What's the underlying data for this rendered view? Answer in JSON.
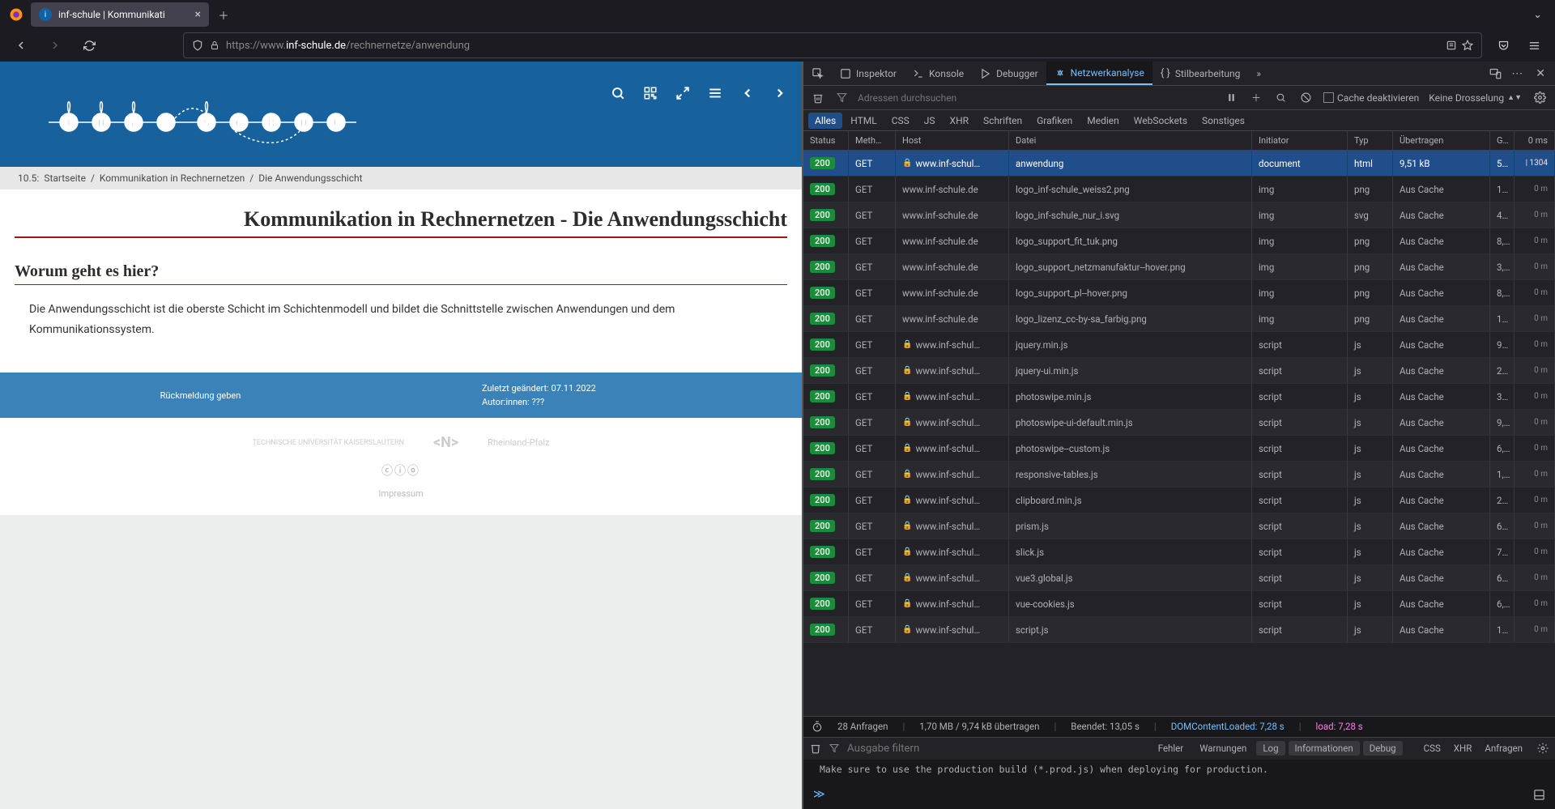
{
  "browser": {
    "tab_title": "inf-schule | Kommunikati",
    "url_prefix": "https://www.",
    "url_host": "inf-schule.de",
    "url_path": "/rechnernetze/anwendung"
  },
  "page": {
    "breadcrumb_prefix": "10.5:",
    "breadcrumb": [
      "Startseite",
      "Kommunikation in Rechnernetzen",
      "Die Anwendungsschicht"
    ],
    "title": "Kommunikation in Rechnernetzen - Die Anwendungsschicht",
    "section_heading": "Worum geht es hier?",
    "section_text": "Die Anwendungsschicht ist die oberste Schicht im Schichtenmodell und bildet die Schnittstelle zwischen Anwendungen und dem Kommunikationssystem.",
    "footer_feedback": "Rückmeldung geben",
    "footer_modified": "Zuletzt geändert: 07.11.2022",
    "footer_authors": "Autor:innen: ???",
    "sponsors": [
      "TECHNISCHE UNIVERSITÄT KAISERSLAUTERN",
      "<N>",
      "Rheinland-Pfalz"
    ],
    "cc_icons": "ⓒⓘⓞ",
    "impressum": "Impressum"
  },
  "devtools": {
    "tabs": {
      "picker": "",
      "inspector": "Inspektor",
      "console": "Konsole",
      "debugger": "Debugger",
      "network": "Netzwerkanalyse",
      "style": "Stilbearbeitung",
      "more": "»"
    },
    "toolbar": {
      "filter_placeholder": "Adressen durchsuchen",
      "cache_label": "Cache deaktivieren",
      "throttle": "Keine Drosselung"
    },
    "filters": [
      "Alles",
      "HTML",
      "CSS",
      "JS",
      "XHR",
      "Schriften",
      "Grafiken",
      "Medien",
      "WebSockets",
      "Sonstiges"
    ],
    "columns": {
      "status": "Status",
      "method": "Meth…",
      "host": "Host",
      "file": "Datei",
      "initiator": "Initiator",
      "type": "Typ",
      "transferred": "Übertragen",
      "size": "G…",
      "waterfall": "0 ms"
    },
    "requests": [
      {
        "status": "200",
        "method": "GET",
        "host": "www.inf-schul…",
        "lock": true,
        "file": "anwendung",
        "initiator": "document",
        "type": "html",
        "transferred": "9,51 kB",
        "size": "5…",
        "selected": true
      },
      {
        "status": "200",
        "method": "GET",
        "host": "www.inf-schule.de",
        "lock": false,
        "file": "logo_inf-schule_weiss2.png",
        "initiator": "img",
        "type": "png",
        "transferred": "Aus Cache",
        "size": "1…"
      },
      {
        "status": "200",
        "method": "GET",
        "host": "www.inf-schule.de",
        "lock": false,
        "file": "logo_inf-schule_nur_i.svg",
        "initiator": "img",
        "type": "svg",
        "transferred": "Aus Cache",
        "size": "4…"
      },
      {
        "status": "200",
        "method": "GET",
        "host": "www.inf-schule.de",
        "lock": false,
        "file": "logo_support_fit_tuk.png",
        "initiator": "img",
        "type": "png",
        "transferred": "Aus Cache",
        "size": "8,…"
      },
      {
        "status": "200",
        "method": "GET",
        "host": "www.inf-schule.de",
        "lock": false,
        "file": "logo_support_netzmanufaktur--hover.png",
        "initiator": "img",
        "type": "png",
        "transferred": "Aus Cache",
        "size": "3,…"
      },
      {
        "status": "200",
        "method": "GET",
        "host": "www.inf-schule.de",
        "lock": false,
        "file": "logo_support_pl--hover.png",
        "initiator": "img",
        "type": "png",
        "transferred": "Aus Cache",
        "size": "8,…"
      },
      {
        "status": "200",
        "method": "GET",
        "host": "www.inf-schule.de",
        "lock": false,
        "file": "logo_lizenz_cc-by-sa_farbig.png",
        "initiator": "img",
        "type": "png",
        "transferred": "Aus Cache",
        "size": "1…"
      },
      {
        "status": "200",
        "method": "GET",
        "host": "www.inf-schul…",
        "lock": true,
        "file": "jquery.min.js",
        "initiator": "script",
        "type": "js",
        "transferred": "Aus Cache",
        "size": "9…"
      },
      {
        "status": "200",
        "method": "GET",
        "host": "www.inf-schul…",
        "lock": true,
        "file": "jquery-ui.min.js",
        "initiator": "script",
        "type": "js",
        "transferred": "Aus Cache",
        "size": "2…"
      },
      {
        "status": "200",
        "method": "GET",
        "host": "www.inf-schul…",
        "lock": true,
        "file": "photoswipe.min.js",
        "initiator": "script",
        "type": "js",
        "transferred": "Aus Cache",
        "size": "3…"
      },
      {
        "status": "200",
        "method": "GET",
        "host": "www.inf-schul…",
        "lock": true,
        "file": "photoswipe-ui-default.min.js",
        "initiator": "script",
        "type": "js",
        "transferred": "Aus Cache",
        "size": "9,…"
      },
      {
        "status": "200",
        "method": "GET",
        "host": "www.inf-schul…",
        "lock": true,
        "file": "photoswipe--custom.js",
        "initiator": "script",
        "type": "js",
        "transferred": "Aus Cache",
        "size": "6,…"
      },
      {
        "status": "200",
        "method": "GET",
        "host": "www.inf-schul…",
        "lock": true,
        "file": "responsive-tables.js",
        "initiator": "script",
        "type": "js",
        "transferred": "Aus Cache",
        "size": "1,…"
      },
      {
        "status": "200",
        "method": "GET",
        "host": "www.inf-schul…",
        "lock": true,
        "file": "clipboard.min.js",
        "initiator": "script",
        "type": "js",
        "transferred": "Aus Cache",
        "size": "2…"
      },
      {
        "status": "200",
        "method": "GET",
        "host": "www.inf-schul…",
        "lock": true,
        "file": "prism.js",
        "initiator": "script",
        "type": "js",
        "transferred": "Aus Cache",
        "size": "6…"
      },
      {
        "status": "200",
        "method": "GET",
        "host": "www.inf-schul…",
        "lock": true,
        "file": "slick.js",
        "initiator": "script",
        "type": "js",
        "transferred": "Aus Cache",
        "size": "7…"
      },
      {
        "status": "200",
        "method": "GET",
        "host": "www.inf-schul…",
        "lock": true,
        "file": "vue3.global.js",
        "initiator": "script",
        "type": "js",
        "transferred": "Aus Cache",
        "size": "6…"
      },
      {
        "status": "200",
        "method": "GET",
        "host": "www.inf-schul…",
        "lock": true,
        "file": "vue-cookies.js",
        "initiator": "script",
        "type": "js",
        "transferred": "Aus Cache",
        "size": "6,…"
      },
      {
        "status": "200",
        "method": "GET",
        "host": "www.inf-schul…",
        "lock": true,
        "file": "script.js",
        "initiator": "script",
        "type": "js",
        "transferred": "Aus Cache",
        "size": "1…"
      }
    ],
    "statusbar": {
      "requests": "28 Anfragen",
      "transferred": "1,70 MB / 9,74 kB übertragen",
      "finish": "Beendet: 13,05 s",
      "dcl": "DOMContentLoaded: 7,28 s",
      "load": "load: 7,28 s"
    },
    "console": {
      "filter_placeholder": "Ausgabe filtern",
      "pills": [
        "Fehler",
        "Warnungen",
        "Log",
        "Informationen",
        "Debug"
      ],
      "right": [
        "CSS",
        "XHR",
        "Anfragen"
      ],
      "msg": "Make sure to use the production build (*.prod.js) when deploying for production."
    },
    "wf_label": "1304",
    "wf_zero": "0 m"
  }
}
